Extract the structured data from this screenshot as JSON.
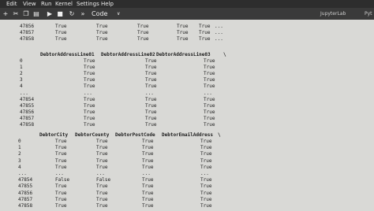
{
  "menu": {
    "items": [
      "Edit",
      "View",
      "Run",
      "Kernel",
      "Settings",
      "Help"
    ]
  },
  "toolbar": {
    "cell_type": "Code",
    "app_name": "JupyterLab",
    "kernel_name": "Pyt"
  },
  "output": {
    "block1": {
      "rows": [
        {
          "index": "47856",
          "values": [
            "True",
            "True",
            "True",
            "True",
            "True",
            "..."
          ]
        },
        {
          "index": "47857",
          "values": [
            "True",
            "True",
            "True",
            "True",
            "True",
            "..."
          ]
        },
        {
          "index": "47858",
          "values": [
            "True",
            "True",
            "True",
            "True",
            "True",
            "..."
          ]
        }
      ]
    },
    "block2": {
      "columns": [
        "DebtorAddressLine01",
        "DebtorAddressLine02",
        "DebtorAddressLine03",
        "\\"
      ],
      "rows": [
        {
          "index": "0",
          "values": [
            "True",
            "True",
            "True"
          ]
        },
        {
          "index": "1",
          "values": [
            "True",
            "True",
            "True"
          ]
        },
        {
          "index": "2",
          "values": [
            "True",
            "True",
            "True"
          ]
        },
        {
          "index": "3",
          "values": [
            "True",
            "True",
            "True"
          ]
        },
        {
          "index": "4",
          "values": [
            "True",
            "True",
            "True"
          ]
        },
        {
          "index": "...",
          "values": [
            "...",
            "...",
            "..."
          ]
        },
        {
          "index": "47854",
          "values": [
            "True",
            "True",
            "True"
          ]
        },
        {
          "index": "47855",
          "values": [
            "True",
            "True",
            "True"
          ]
        },
        {
          "index": "47856",
          "values": [
            "True",
            "True",
            "True"
          ]
        },
        {
          "index": "47857",
          "values": [
            "True",
            "True",
            "True"
          ]
        },
        {
          "index": "47858",
          "values": [
            "True",
            "True",
            "True"
          ]
        }
      ]
    },
    "block3": {
      "columns": [
        "DebtorCity",
        "DebtorCounty",
        "DebtorPostCode",
        "DebtorEmailAddress",
        "\\"
      ],
      "rows": [
        {
          "index": "0",
          "values": [
            "True",
            "True",
            "True",
            "True"
          ]
        },
        {
          "index": "1",
          "values": [
            "True",
            "True",
            "True",
            "True"
          ]
        },
        {
          "index": "2",
          "values": [
            "True",
            "True",
            "True",
            "True"
          ]
        },
        {
          "index": "3",
          "values": [
            "True",
            "True",
            "True",
            "True"
          ]
        },
        {
          "index": "4",
          "values": [
            "True",
            "True",
            "True",
            "True"
          ]
        },
        {
          "index": "...",
          "values": [
            "...",
            "...",
            "...",
            "..."
          ]
        },
        {
          "index": "47854",
          "values": [
            "False",
            "False",
            "True",
            "True"
          ]
        },
        {
          "index": "47855",
          "values": [
            "True",
            "True",
            "True",
            "True"
          ]
        },
        {
          "index": "47856",
          "values": [
            "True",
            "True",
            "True",
            "True"
          ]
        },
        {
          "index": "47857",
          "values": [
            "True",
            "True",
            "True",
            "True"
          ]
        },
        {
          "index": "47858",
          "values": [
            "True",
            "True",
            "True",
            "True"
          ]
        }
      ]
    }
  }
}
